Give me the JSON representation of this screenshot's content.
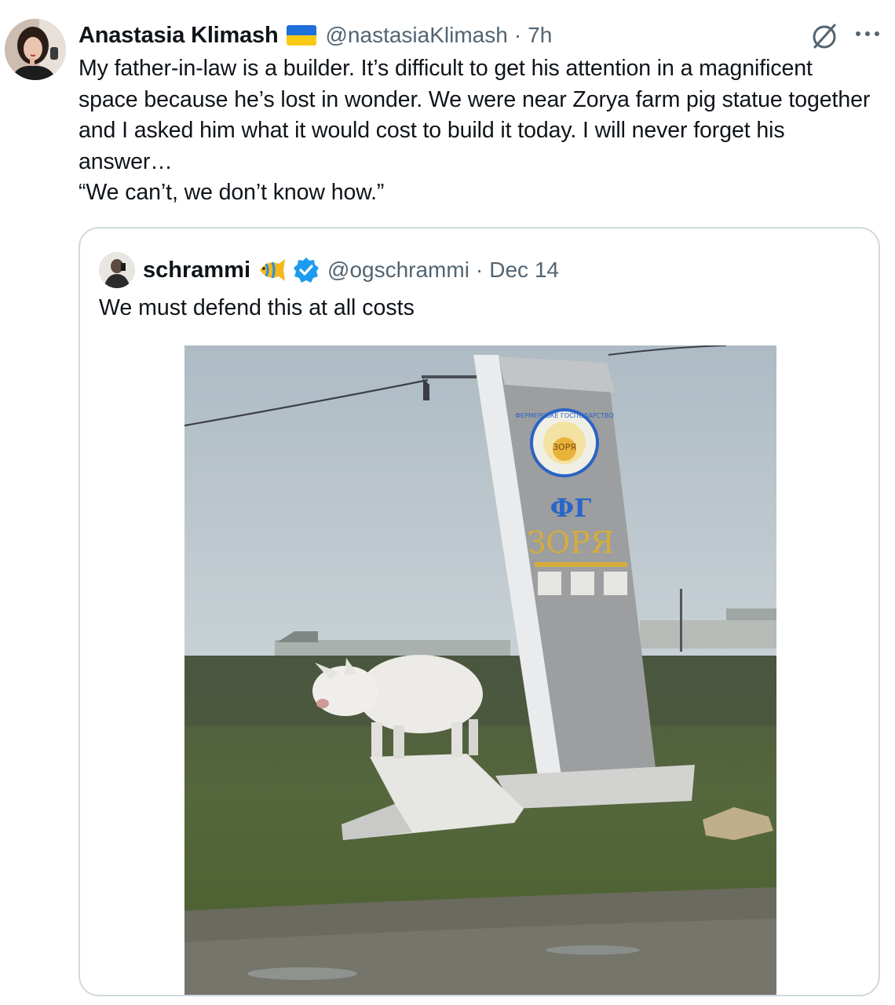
{
  "tweet": {
    "author_name": "Anastasia Klimash",
    "handle": "@nastasiaKlimash",
    "separator": "·",
    "time": "7h",
    "paragraphs": [
      "My father-in-law is a builder. It’s difficult to get his attention in a magnificent space because he’s lost in wonder. We were near Zorya farm pig statue together and I asked him what it would cost to build it today. I will never forget his answer…",
      "“We can’t, we don’t know how.”"
    ]
  },
  "quote": {
    "author_name": "schrammi",
    "handle": "@ogschrammi",
    "separator": "·",
    "date": "Dec 14",
    "text": "We must defend this at all costs",
    "media_sign": {
      "emblem_ring_text": "ФЕРМЕРСЬКЕ ГОСПОДАРСТВО",
      "emblem_center_text": "ЗОРЯ",
      "abbr": "ФГ",
      "title": "ЗОРЯ"
    }
  },
  "icons": {
    "flag": "ukraine-flag-icon",
    "grok": "grok-icon",
    "more": "more-icon",
    "fish": "tropical-fish-icon",
    "verified": "verified-badge-icon"
  },
  "colors": {
    "muted": "#536471",
    "border": "#cfd9de",
    "verified": "#1d9bf0",
    "flag_blue": "#1e6fd9",
    "flag_yellow": "#f7cb15"
  }
}
